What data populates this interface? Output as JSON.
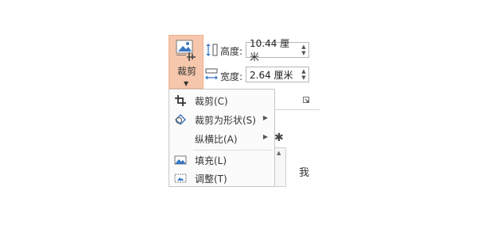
{
  "crop_button": {
    "label": "裁剪"
  },
  "size": {
    "height": {
      "label": "高度:",
      "value": "10.44 厘米"
    },
    "width": {
      "label": "宽度:",
      "value": "2.64 厘米"
    }
  },
  "menu": {
    "items": [
      {
        "label": "裁剪(C)",
        "icon": "crop-icon",
        "has_submenu": false
      },
      {
        "label": "裁剪为形状(S)",
        "icon": "shape-crop-icon",
        "has_submenu": true
      },
      {
        "label": "纵横比(A)",
        "icon": "",
        "has_submenu": true
      },
      {
        "label": "填充(L)",
        "icon": "fill-icon",
        "has_submenu": false
      },
      {
        "label": "调整(T)",
        "icon": "fit-icon",
        "has_submenu": false
      }
    ]
  },
  "background": {
    "text": "我"
  },
  "colors": {
    "crop_button_bg": "#f6c7ac",
    "accent_blue": "#2f6fbf"
  }
}
